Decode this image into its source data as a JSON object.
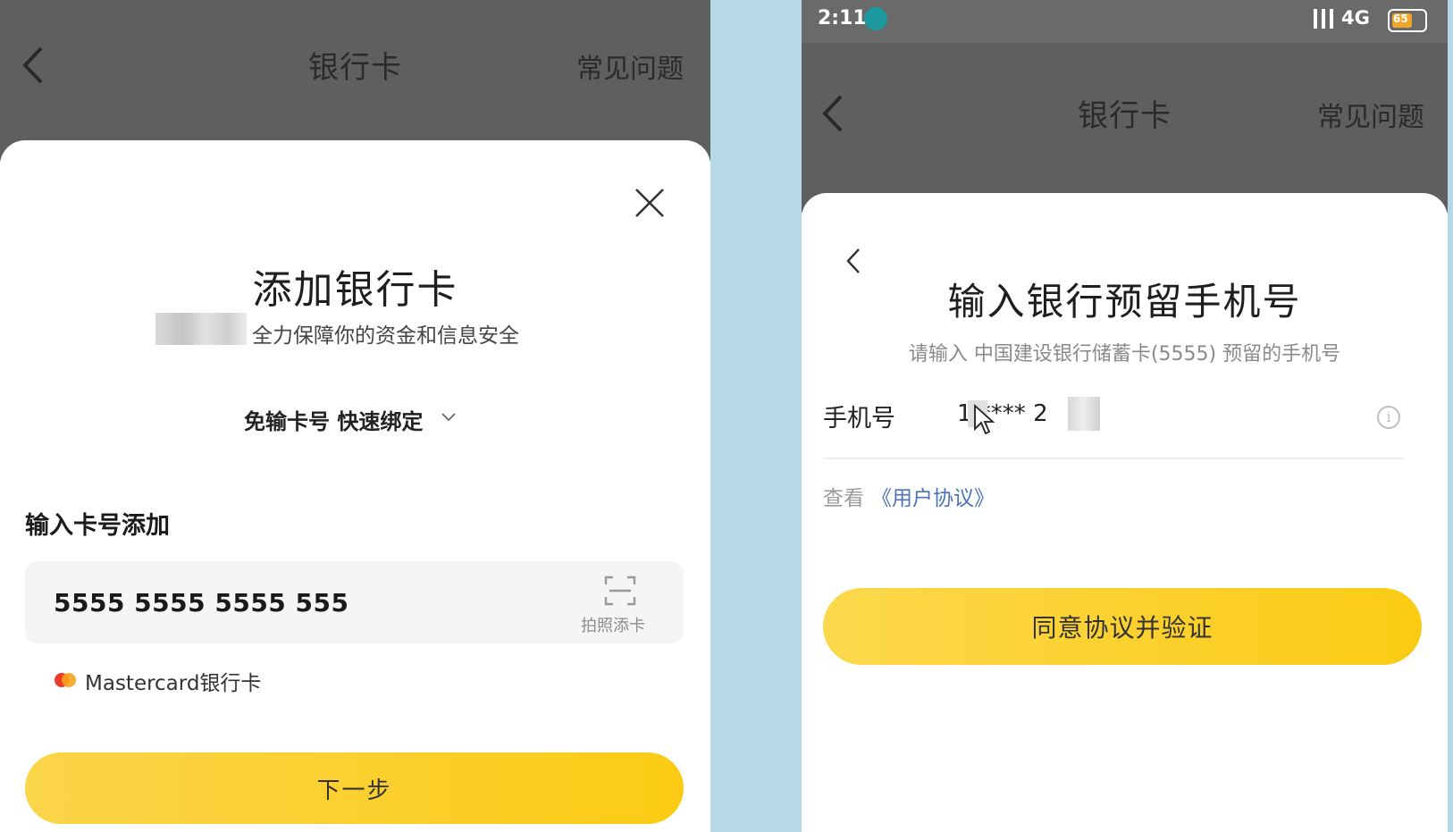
{
  "left_screen": {
    "nav": {
      "title": "银行卡",
      "faq": "常见问题"
    },
    "sheet": {
      "heading": "添加银行卡",
      "subtitle": "全力保障你的资金和信息安全",
      "quick_bind": "免输卡号 快速绑定",
      "section_title": "输入卡号添加",
      "card_input": {
        "value": "5555 5555 5555 555",
        "scan_label": "拍照添卡"
      },
      "card_brand": "Mastercard银行卡",
      "next_button": "下一步"
    }
  },
  "right_screen": {
    "status_bar": {
      "time": "2:11",
      "network": "4G",
      "battery": "65"
    },
    "nav": {
      "title": "银行卡",
      "faq": "常见问题"
    },
    "sheet": {
      "heading": "输入银行预留手机号",
      "subtitle": "请输入 中国建设银行储蓄卡(5555) 预留的手机号",
      "phone_label": "手机号",
      "phone_value": "1  **** 2",
      "agreement_prefix": "查看",
      "agreement_link": "《用户协议》",
      "verify_button": "同意协议并验证"
    }
  },
  "colors": {
    "accent_yellow": "#fbcb14",
    "dim_overlay": "#5f5f5f",
    "link_blue": "#4a73b8",
    "divider": "#b6d9e7"
  }
}
